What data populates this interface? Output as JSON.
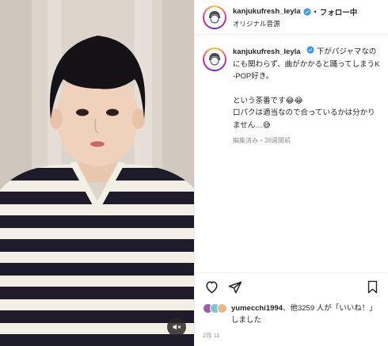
{
  "post": {
    "username": "kanjukufresh_leyla",
    "separator": "•",
    "follow_label": "フォロー中",
    "audio_label": "オリジナル音源"
  },
  "caption": {
    "username": "kanjukufresh_leyla",
    "line1": "下がパジャマなのにも関わらず、曲がかかると踊ってしまうK-POP好き。",
    "line2": "という茶番です😂😂",
    "line3": "口パクは適当なので合っているかは分かりません…😅",
    "meta": "編集済み・38週間前"
  },
  "likes": {
    "user": "yumecchi1994",
    "text_mid": "、他3259 人が「いいね！」しました",
    "count": 3259
  },
  "date": "2月 11",
  "icons": {
    "verified": "verified-badge-icon",
    "heart": "heart-icon",
    "share": "send-icon",
    "save": "bookmark-icon",
    "mute": "speaker-muted-icon"
  },
  "colors": {
    "verified": "#3897f0",
    "text": "#262626",
    "muted": "#8e8e8e"
  }
}
